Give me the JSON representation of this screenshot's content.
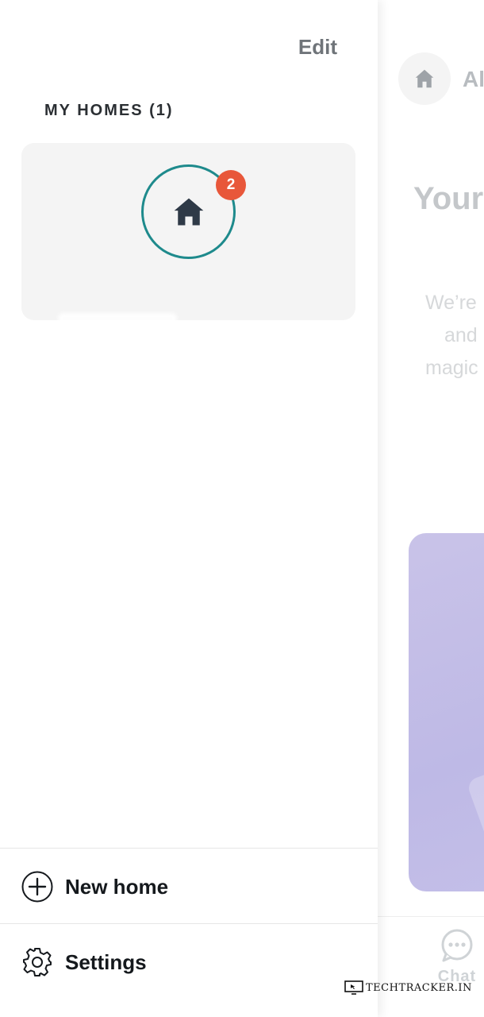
{
  "background": {
    "home_name": "Al",
    "title": "Your",
    "description_lines": [
      "We’re",
      "and",
      "magic"
    ],
    "bottom_nav": {
      "chat_label": "Chat"
    },
    "card_color": "#c2bde8"
  },
  "drawer": {
    "edit_label": "Edit",
    "section_title": "MY HOMES (1)",
    "home": {
      "badge_count": "2",
      "ring_color": "#1e8a8c",
      "badge_color": "#e8573a"
    },
    "new_home_label": "New home",
    "settings_label": "Settings"
  },
  "watermark": {
    "text": "TECHTRACKER.IN"
  },
  "icons": [
    "home-icon",
    "chat-icon",
    "plus-circle-icon",
    "gear-icon",
    "monitor-icon"
  ]
}
